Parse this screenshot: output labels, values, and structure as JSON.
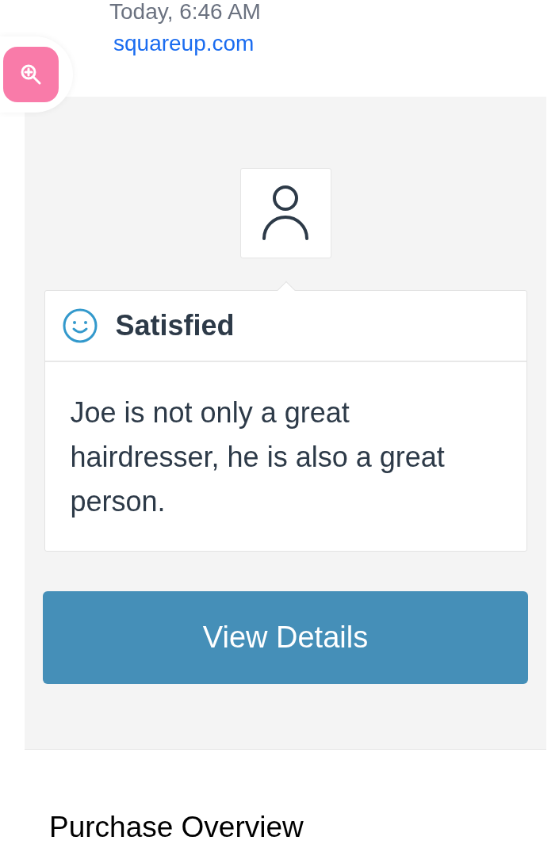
{
  "header": {
    "timestamp": "Today, 6:46 AM",
    "link": "squareup.com"
  },
  "feedback": {
    "sentiment": {
      "kind": "satisfied",
      "label": "Satisfied"
    },
    "comment": "Joe is not only a great hairdresser, he is also a great person."
  },
  "details_button": "View Details",
  "section_title": "Purchase Overview"
}
